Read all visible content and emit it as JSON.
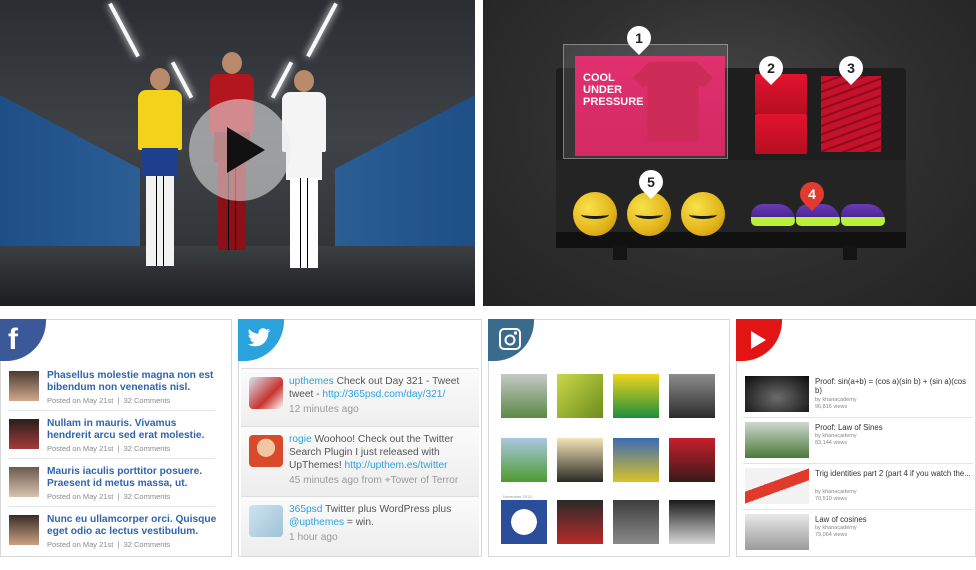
{
  "hero": {
    "play_button": "play"
  },
  "product_display": {
    "pink_box_text": "COOL UNDER PRESSURE",
    "hotspots": [
      "1",
      "2",
      "3",
      "4",
      "5"
    ],
    "active_hotspot": "4"
  },
  "facebook": {
    "icon": "facebook-icon",
    "brand_color": "#3b5998",
    "posts": [
      {
        "title": "Phasellus molestie magna non est bibendum non venenatis nisl.",
        "date": "Posted on May 21st",
        "comments": "32 Comments"
      },
      {
        "title": "Nullam in mauris. Vivamus hendrerit arcu sed erat molestie.",
        "date": "Posted on May 21st",
        "comments": "32 Comments"
      },
      {
        "title": "Mauris iaculis porttitor posuere. Praesent id metus massa, ut.",
        "date": "Posted on May 21st",
        "comments": "32 Comments"
      },
      {
        "title": "Nunc eu ullamcorper orci. Quisque eget odio ac lectus vestibulum.",
        "date": "Posted on May 21st",
        "comments": "32 Comments"
      }
    ]
  },
  "twitter": {
    "icon": "twitter-bird-icon",
    "brand_color": "#2aa3dd",
    "tweets": [
      {
        "user": "upthemes",
        "text": "Check out Day 321 - Tweet tweet - ",
        "link": "http://365psd.com/day/321/",
        "time": "12 minutes ago",
        "place": ""
      },
      {
        "user": "rogie",
        "text": "Woohoo! Check out the Twitter Search Plugin I just released with UpThemes! ",
        "link": "http://upthem.es/twitter",
        "time": "45 minutes ago from",
        "place": "Tower of Terror"
      },
      {
        "user": "365psd",
        "text": "Twitter plus WordPress plus ",
        "mention": "@upthemes",
        "text_after": " = win.",
        "time": "1 hour ago"
      }
    ]
  },
  "instagram": {
    "icon": "instagram-camera-icon",
    "brand_color": "#3a6b8c",
    "date_label": "November 2013"
  },
  "youtube": {
    "icon": "youtube-play-icon",
    "brand_color": "#e31414",
    "videos": [
      {
        "title": "Proof: sin(a+b) = (cos a)(sin b) + (sin a)(cos b)",
        "by": "by khanacademy",
        "views": "96,816 views"
      },
      {
        "title": "Proof: Law of Sines",
        "by": "by khanacademy",
        "views": "83,144 views"
      },
      {
        "title": "Trig identities part 2 (part 4 if you watch the...",
        "by": "by khanacademy",
        "views": "70,510 views"
      },
      {
        "title": "Law of cosines",
        "by": "by khanacademy",
        "views": "79,064 views"
      }
    ]
  }
}
